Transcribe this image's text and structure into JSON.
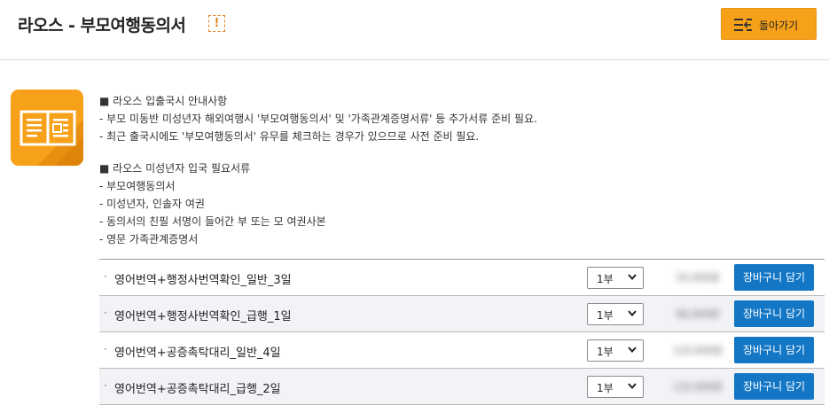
{
  "header": {
    "title": "라오스 - 부모여행동의서",
    "warn_glyph": "!",
    "back_label": "돌아가기",
    "accent_color": "#f7a11a"
  },
  "notice": {
    "lines_a": [
      "■ 라오스 입출국시 안내사항",
      "- 부모 미동반 미성년자 해외여행시 '부모여행동의서' 및 '가족관계증명서류' 등 추가서류 준비 필요.",
      "- 최근 출국시에도 '부모여행동의서' 유무를 체크하는 경우가 있으므로 사전 준비 필요."
    ],
    "lines_b": [
      "■ 라오스 미성년자 입국 필요서류",
      "- 부모여행동의서",
      "- 미성년자, 인솔자 여권",
      "- 동의서의 친필 서명이 들어간 부 또는 모 여권사본",
      "- 영문 가족관계증명서"
    ]
  },
  "products": [
    {
      "bullet": "·",
      "name": "영어번역+행정사번역확인_일반_3일",
      "qty": "1부",
      "price": "55,000원",
      "cart_label": "장바구니 담기"
    },
    {
      "bullet": "·",
      "name": "영어번역+행정사번역확인_급행_1일",
      "qty": "1부",
      "price": "66,000원",
      "cart_label": "장바구니 담기"
    },
    {
      "bullet": "·",
      "name": "영어번역+공증촉탁대리_일반_4일",
      "qty": "1부",
      "price": "110,000원",
      "cart_label": "장바구니 담기"
    },
    {
      "bullet": "·",
      "name": "영어번역+공증촉탁대리_급행_2일",
      "qty": "1부",
      "price": "132,000원",
      "cart_label": "장바구니 담기"
    }
  ],
  "icons": {
    "warn": "exclamation-icon",
    "back": "list-back-icon",
    "doc": "document-book-icon",
    "select": "chevron-down-icon"
  }
}
